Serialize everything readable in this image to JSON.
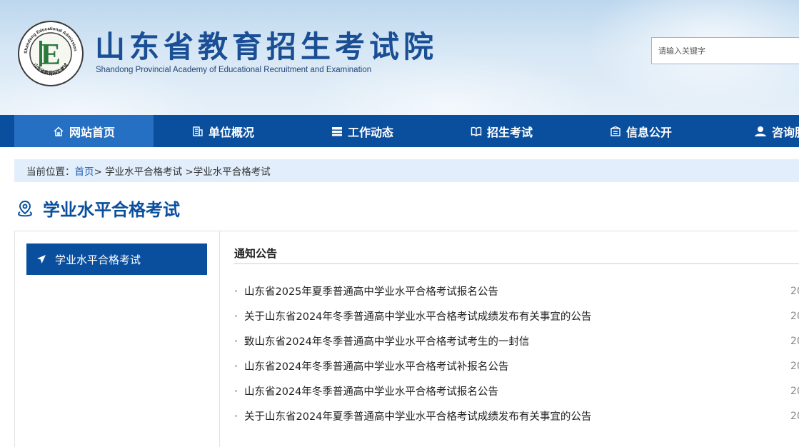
{
  "header": {
    "title": "山东省教育招生考试院",
    "subtitle": "Shandong Provincial Academy of Educational Recruitment and Examination",
    "logo": {
      "icon": "seal-logo-icon",
      "ring_text": "Shandong Educational Admission & Examination",
      "center_letter": "E",
      "bottom_text": "山东省教育招生考试"
    },
    "search": {
      "placeholder": "请输入关键字",
      "value": ""
    }
  },
  "nav": {
    "items": [
      {
        "label": "网站首页",
        "icon": "home-icon",
        "active": true
      },
      {
        "label": "单位概况",
        "icon": "building-icon",
        "active": false
      },
      {
        "label": "工作动态",
        "icon": "news-icon",
        "active": false
      },
      {
        "label": "招生考试",
        "icon": "book-icon",
        "active": false
      },
      {
        "label": "信息公开",
        "icon": "info-folder-icon",
        "active": false
      },
      {
        "label": "咨询服",
        "icon": "user-service-icon",
        "active": false
      }
    ]
  },
  "breadcrumb": {
    "prefix": "当前位置：",
    "home": "首页",
    "rest": " > 学业水平合格考试 >学业水平合格考试"
  },
  "page": {
    "heading": "学业水平合格考试",
    "heading_icon": "location-pin-icon"
  },
  "sidebar": {
    "items": [
      {
        "label": "学业水平合格考试",
        "icon": "arrow-pointer-icon",
        "active": true
      }
    ]
  },
  "main": {
    "section_title": "通知公告",
    "notices": [
      {
        "title": "山东省2025年夏季普通高中学业水平合格考试报名公告",
        "date": "20"
      },
      {
        "title": "关于山东省2024年冬季普通高中学业水平合格考试成绩发布有关事宜的公告",
        "date": "20"
      },
      {
        "title": "致山东省2024年冬季普通高中学业水平合格考试考生的一封信",
        "date": "20"
      },
      {
        "title": "山东省2024年冬季普通高中学业水平合格考试补报名公告",
        "date": "20"
      },
      {
        "title": "山东省2024年冬季普通高中学业水平合格考试报名公告",
        "date": "20"
      },
      {
        "title": "关于山东省2024年夏季普通高中学业水平合格考试成绩发布有关事宜的公告",
        "date": "20"
      }
    ]
  },
  "colors": {
    "brand": "#0a4f9e",
    "nav_active": "#2670c4",
    "breadcrumb_bg": "#e2eefb",
    "title_blue": "#1a4f95",
    "logo_green": "#2a7a3c"
  }
}
